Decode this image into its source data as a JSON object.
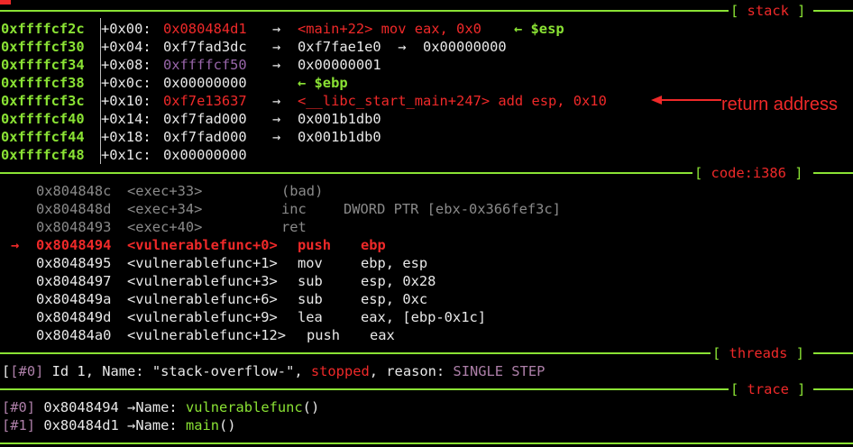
{
  "headers": {
    "stack": "stack",
    "code": "code:i386",
    "threads": "threads",
    "trace": "trace"
  },
  "stack": [
    {
      "addr": "0xffffcf2c",
      "off": "+0x00:",
      "val": "0x080484d1",
      "arrow": "→",
      "deref": "<main+22> mov eax, 0x0",
      "note": "← $esp"
    },
    {
      "addr": "0xffffcf30",
      "off": "+0x04:",
      "val": "0xf7fad3dc",
      "arrow": "→",
      "deref": "0xf7fae1e0  →  0x00000000",
      "note": ""
    },
    {
      "addr": "0xffffcf34",
      "off": "+0x08:",
      "val": "0xffffcf50",
      "arrow": "→",
      "deref": "0x00000001",
      "note": ""
    },
    {
      "addr": "0xffffcf38",
      "off": "+0x0c:",
      "val": "0x00000000",
      "arrow": "",
      "deref": "",
      "note": "← $ebp"
    },
    {
      "addr": "0xffffcf3c",
      "off": "+0x10:",
      "val": "0xf7e13637",
      "arrow": "→",
      "deref": "<__libc_start_main+247> add esp, 0x10",
      "note": ""
    },
    {
      "addr": "0xffffcf40",
      "off": "+0x14:",
      "val": "0xf7fad000",
      "arrow": "→",
      "deref": "0x001b1db0",
      "note": ""
    },
    {
      "addr": "0xffffcf44",
      "off": "+0x18:",
      "val": "0xf7fad000",
      "arrow": "→",
      "deref": "0x001b1db0",
      "note": ""
    },
    {
      "addr": "0xffffcf48",
      "off": "+0x1c:",
      "val": "0x00000000",
      "arrow": "",
      "deref": "",
      "note": ""
    }
  ],
  "annotation": "return address",
  "code": [
    {
      "marker": "",
      "addr": "0x804848c",
      "sym": "<exec+33>",
      "mn": "(bad)",
      "ops": ""
    },
    {
      "marker": "",
      "addr": "0x804848d",
      "sym": "<exec+34>",
      "mn": "inc",
      "ops": "DWORD PTR [ebx-0x366fef3c]"
    },
    {
      "marker": "",
      "addr": "0x8048493",
      "sym": "<exec+40>",
      "mn": "ret",
      "ops": ""
    },
    {
      "marker": "→",
      "addr": "0x8048494",
      "sym": "<vulnerablefunc+0>",
      "mn": "push",
      "ops": "ebp"
    },
    {
      "marker": "",
      "addr": "0x8048495",
      "sym": "<vulnerablefunc+1>",
      "mn": "mov",
      "ops": "ebp, esp"
    },
    {
      "marker": "",
      "addr": "0x8048497",
      "sym": "<vulnerablefunc+3>",
      "mn": "sub",
      "ops": "esp, 0x28"
    },
    {
      "marker": "",
      "addr": "0x804849a",
      "sym": "<vulnerablefunc+6>",
      "mn": "sub",
      "ops": "esp, 0xc"
    },
    {
      "marker": "",
      "addr": "0x804849d",
      "sym": "<vulnerablefunc+9>",
      "mn": "lea",
      "ops": "eax, [ebp-0x1c]"
    },
    {
      "marker": "",
      "addr": "0x80484a0",
      "sym": "<vulnerablefunc+12>",
      "mn": "push",
      "ops": "eax"
    }
  ],
  "threads": {
    "idx": "[#0]",
    "pre": " Id 1, Name: \"stack-overflow-\", ",
    "state": "stopped",
    "mid": ", reason: ",
    "reason": "SINGLE STEP"
  },
  "trace": [
    {
      "idx": "[#0]",
      "addr": "0x8048494",
      "arrow": "→",
      "name": "Name: ",
      "func": "vulnerablefunc",
      "paren": "()"
    },
    {
      "idx": "[#1]",
      "addr": "0x80484d1",
      "arrow": "→",
      "name": "Name: ",
      "func": "main",
      "paren": "()"
    }
  ]
}
